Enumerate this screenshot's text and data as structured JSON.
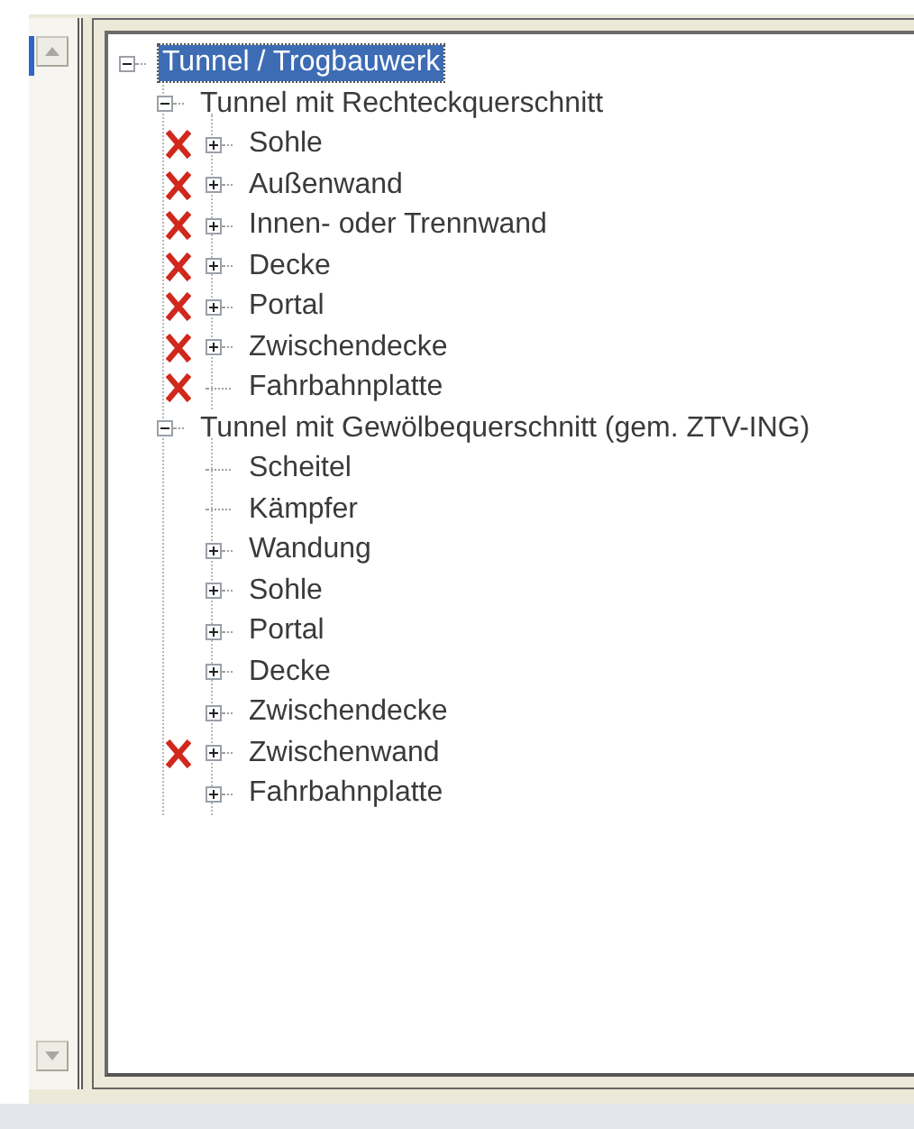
{
  "tree": [
    {
      "label": "Tunnel / Trogbauwerk",
      "selected": true,
      "marked": false,
      "expanded": true,
      "children": [
        {
          "label": "Tunnel mit Rechteckquerschnitt",
          "selected": false,
          "marked": false,
          "expanded": true,
          "children": [
            {
              "label": "Sohle",
              "selected": false,
              "marked": true,
              "expanded": false
            },
            {
              "label": "Außenwand",
              "selected": false,
              "marked": true,
              "expanded": false
            },
            {
              "label": "Innen- oder Trennwand",
              "selected": false,
              "marked": true,
              "expanded": false
            },
            {
              "label": "Decke",
              "selected": false,
              "marked": true,
              "expanded": false
            },
            {
              "label": "Portal",
              "selected": false,
              "marked": true,
              "expanded": false
            },
            {
              "label": "Zwischendecke",
              "selected": false,
              "marked": true,
              "expanded": false
            },
            {
              "label": "Fahrbahnplatte",
              "selected": false,
              "marked": true
            }
          ]
        },
        {
          "label": "Tunnel mit Gewölbequerschnitt (gem. ZTV-ING)",
          "selected": false,
          "marked": false,
          "expanded": true,
          "children": [
            {
              "label": "Scheitel",
              "selected": false,
              "marked": false
            },
            {
              "label": "Kämpfer",
              "selected": false,
              "marked": false
            },
            {
              "label": "Wandung",
              "selected": false,
              "marked": false,
              "expanded": false
            },
            {
              "label": "Sohle",
              "selected": false,
              "marked": false,
              "expanded": false
            },
            {
              "label": "Portal",
              "selected": false,
              "marked": false,
              "expanded": false
            },
            {
              "label": "Decke",
              "selected": false,
              "marked": false,
              "expanded": false
            },
            {
              "label": "Zwischendecke",
              "selected": false,
              "marked": false,
              "expanded": false
            },
            {
              "label": "Zwischenwand",
              "selected": false,
              "marked": true,
              "expanded": false
            },
            {
              "label": "Fahrbahnplatte",
              "selected": false,
              "marked": false,
              "expanded": false
            }
          ]
        }
      ]
    }
  ]
}
